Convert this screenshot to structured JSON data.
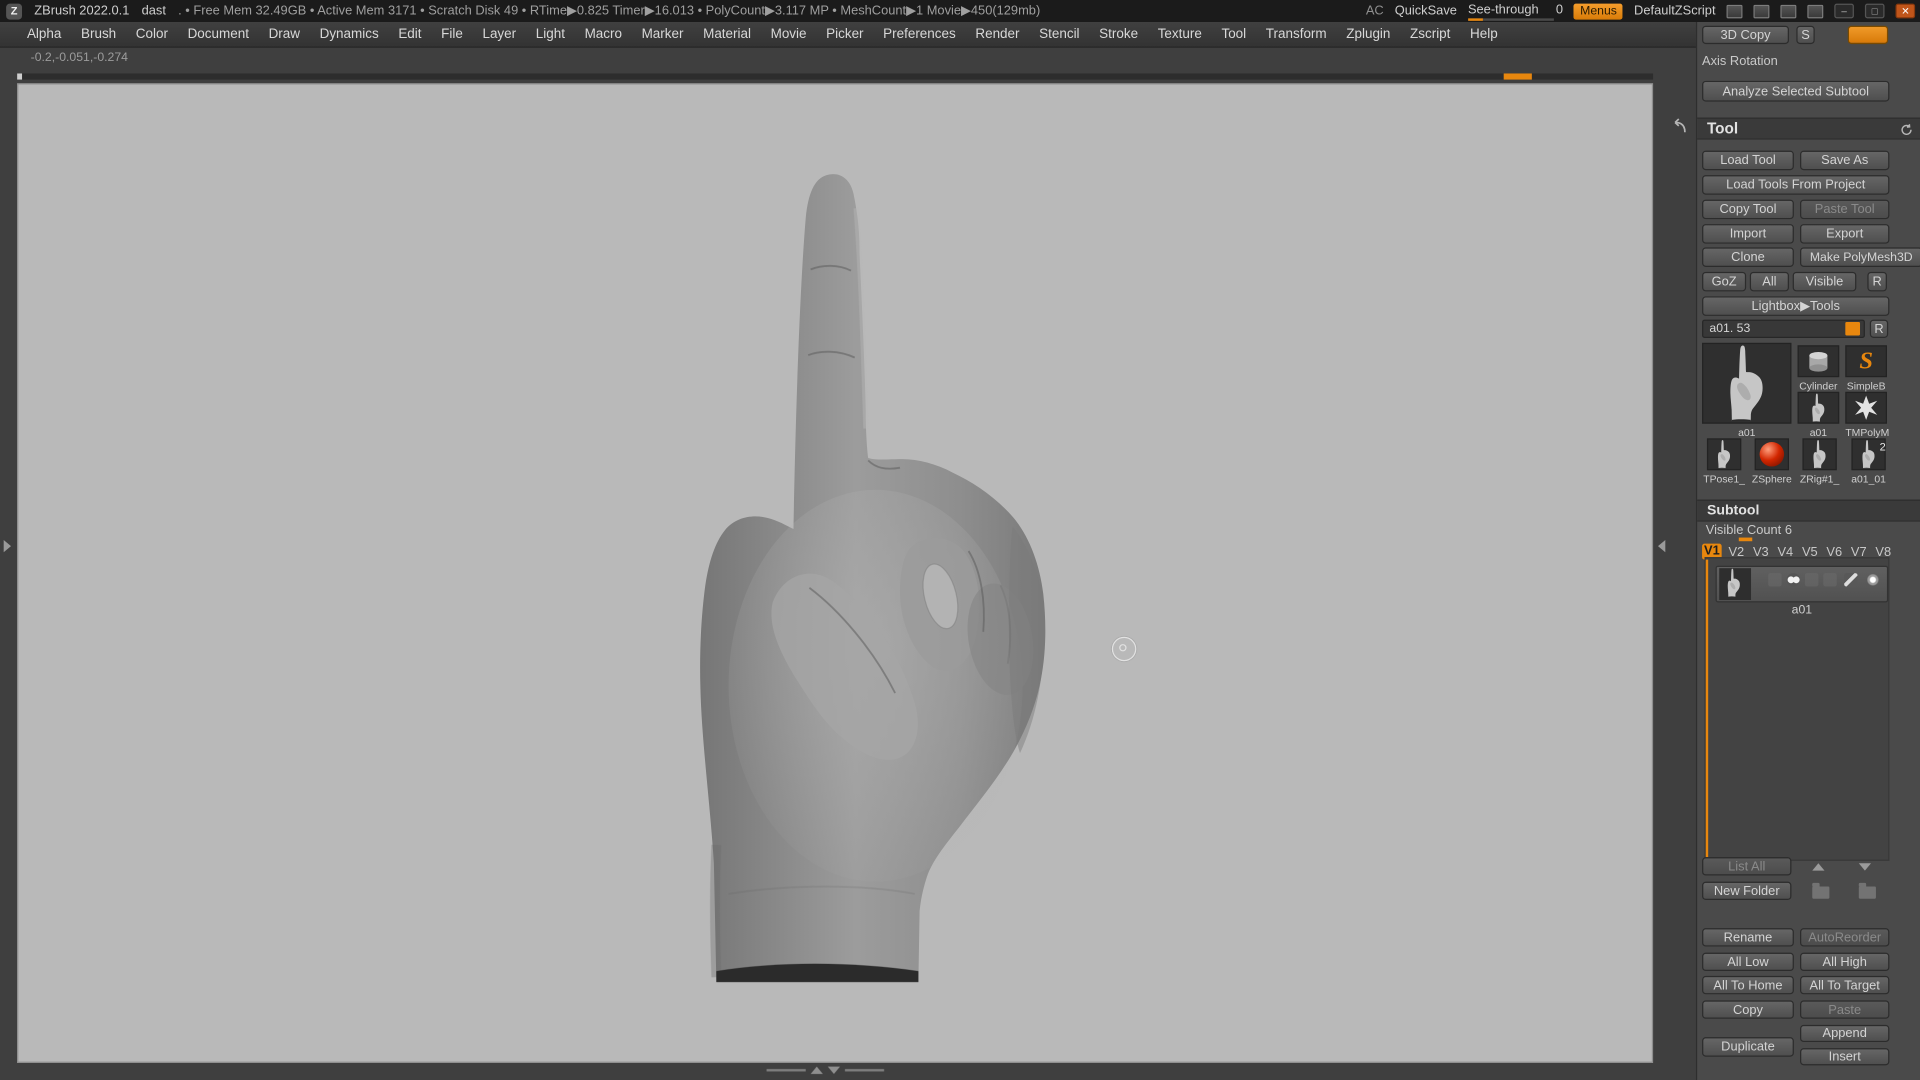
{
  "titlebar": {
    "app_title": "ZBrush 2022.0.1",
    "document_name": "dast",
    "stats": ". • Free Mem 32.49GB • Active Mem 3171 • Scratch Disk 49 •  RTime▶0.825 Timer▶16.013 • PolyCount▶3.117 MP  • MeshCount▶1  Movie▶450(129mb)",
    "ac": "AC",
    "quicksave": "QuickSave",
    "see_through_label": "See-through",
    "see_through_value": "0",
    "menus_button": "Menus",
    "default_zscript": "DefaultZScript"
  },
  "menubar": {
    "items": [
      "Alpha",
      "Brush",
      "Color",
      "Document",
      "Draw",
      "Dynamics",
      "Edit",
      "File",
      "Layer",
      "Light",
      "Macro",
      "Marker",
      "Material",
      "Movie",
      "Picker",
      "Preferences",
      "Render",
      "Stencil",
      "Stroke",
      "Texture",
      "Tool",
      "Transform",
      "Zplugin",
      "Zscript",
      "Help"
    ]
  },
  "canvas": {
    "coordinates": "-0.2,-0.051,-0.274"
  },
  "panel_top": {
    "copy_3d": "3D Copy",
    "s": "S"
  },
  "axis_rotation": {
    "label": "Axis Rotation",
    "analyze_button": "Analyze Selected Subtool"
  },
  "tool": {
    "title": "Tool",
    "load_tool": "Load Tool",
    "save_as": "Save As",
    "load_tools_from_project": "Load Tools From Project",
    "copy_tool": "Copy Tool",
    "paste_tool": "Paste Tool",
    "import": "Import",
    "export": "Export",
    "clone": "Clone",
    "make_polymesh3d": "Make PolyMesh3D",
    "goz": "GoZ",
    "all": "All",
    "visible": "Visible",
    "goz_r": "R",
    "lightbox": "Lightbox▶Tools",
    "active_tool": "a01. 53",
    "slider_r": "R",
    "thumbnails": [
      {
        "label": "a01",
        "kind": "hand"
      },
      {
        "label": "Cylinder",
        "kind": "cylinder"
      },
      {
        "label": "SimpleB",
        "kind": "simplebrush",
        "glyph": "S"
      },
      {
        "label": "a01",
        "kind": "hand"
      },
      {
        "label": "TMPolyM",
        "kind": "star"
      },
      {
        "label": "TPose1_",
        "kind": "hand"
      },
      {
        "label": "ZSphere",
        "kind": "sphere"
      },
      {
        "label": "ZRig#1_",
        "kind": "hand"
      },
      {
        "label": "a01_01",
        "kind": "hand",
        "badge": "2"
      }
    ]
  },
  "subtool": {
    "title": "Subtool",
    "visible_count": "Visible Count 6",
    "tabs": [
      "V1",
      "V2",
      "V3",
      "V4",
      "V5",
      "V6",
      "V7",
      "V8"
    ],
    "active_tab": "V1",
    "items": [
      {
        "label": "a01"
      }
    ],
    "list_all": "List All",
    "new_folder": "New Folder",
    "rename": "Rename",
    "autoreorder": "AutoReorder",
    "all_low": "All Low",
    "all_high": "All High",
    "all_to_home": "All To Home",
    "all_to_target": "All To Target",
    "copy": "Copy",
    "paste": "Paste",
    "duplicate": "Duplicate",
    "append": "Append",
    "insert": "Insert"
  },
  "colors": {
    "accent": "#e8870e",
    "canvas_bg": "#b9b9b9"
  }
}
